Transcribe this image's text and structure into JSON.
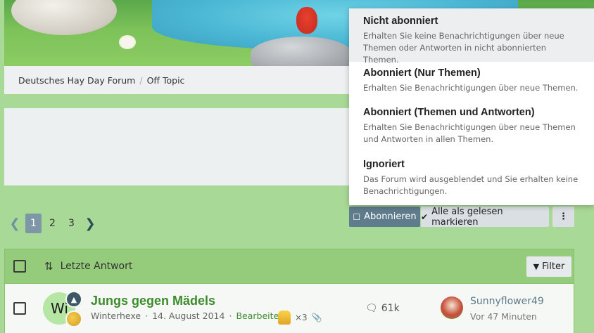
{
  "breadcrumb": {
    "items": [
      "Deutsches Hay Day Forum",
      "Off Topic"
    ],
    "separator": "/"
  },
  "pagination": {
    "pages": [
      "1",
      "2",
      "3"
    ],
    "current": "1"
  },
  "actions": {
    "subscribe_label": "Abonnieren",
    "mark_read_label": "Alle als gelesen markieren",
    "more_label": "⋮"
  },
  "list_header": {
    "sort_label": "Letzte Antwort",
    "filter_label": "Filter"
  },
  "thread": {
    "avatar_letters": "Wi",
    "title": "Jungs gegen Mädels",
    "author": "Winterhexe",
    "date": "14. August 2014",
    "edit_label": "Bearbeiten",
    "reaction_count": "×3",
    "replies": "61k",
    "last_user": "Sunnyflower49",
    "last_time": "Vor 47 Minuten"
  },
  "subscribe_menu": {
    "items": [
      {
        "title": "Nicht abonniert",
        "desc": "Erhalten Sie keine Benachrichtigungen über neue Themen oder Antworten in nicht abonnierten Themen."
      },
      {
        "title": "Abonniert (Nur Themen)",
        "desc": "Erhalten Sie Benachrichtigungen über neue Themen."
      },
      {
        "title": "Abonniert (Themen und Antworten)",
        "desc": "Erhalten Sie Benachrichtigungen über neue Themen und Antworten in allen Themen."
      },
      {
        "title": "Ignoriert",
        "desc": "Das Forum wird ausgeblendet und Sie erhalten keine Benachrichtigungen."
      }
    ]
  },
  "colors": {
    "accent": "#5f7c8c",
    "link_green": "#3d8b2c",
    "header_green": "#94cc7c"
  }
}
